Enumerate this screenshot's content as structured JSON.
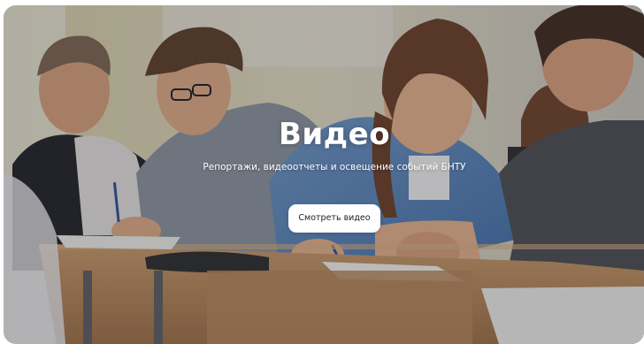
{
  "hero": {
    "title": "Видео",
    "subtitle": "Репортажи, видеоотчеты и освещение событий БНТУ",
    "button_label": "Смотреть видео",
    "background_image": "students-writing-exam-photo"
  },
  "colors": {
    "title_text": "#ffffff",
    "button_bg": "#ffffff",
    "button_text": "#222222"
  }
}
